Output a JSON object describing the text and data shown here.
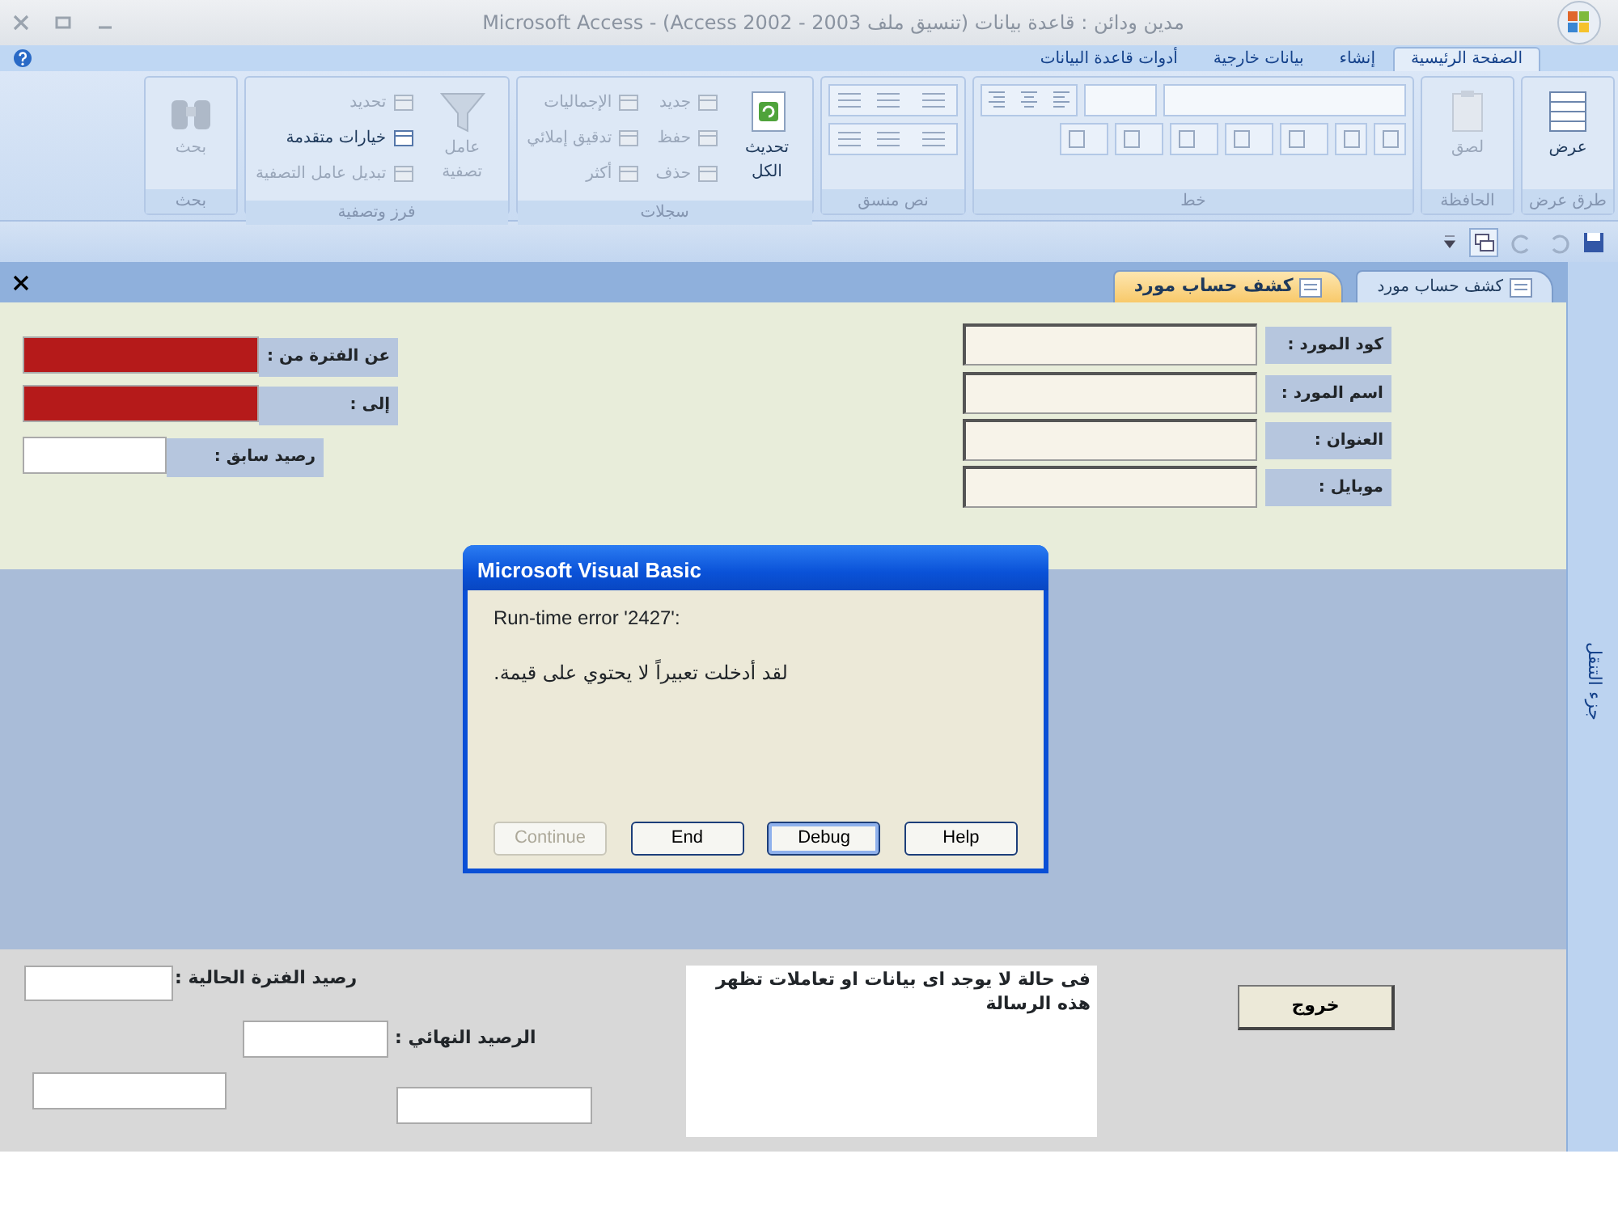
{
  "window": {
    "title": "مدين ودائن : قاعدة بيانات (تنسيق ملف Access 2002 - 2003) - Microsoft Access"
  },
  "ribbon_tabs": [
    {
      "label": "الصفحة الرئيسية",
      "selected": true
    },
    {
      "label": "إنشاء",
      "selected": false
    },
    {
      "label": "بيانات خارجية",
      "selected": false
    },
    {
      "label": "أدوات قاعدة البيانات",
      "selected": false
    }
  ],
  "ribbon_groups": [
    {
      "label": "طرق عرض",
      "kind": "items",
      "items": [
        {
          "label": "عرض",
          "kind": "large",
          "disabled": false
        }
      ]
    },
    {
      "label": "الحافظة",
      "kind": "items",
      "items": [
        {
          "label": "لصق",
          "kind": "large",
          "disabled": true
        }
      ]
    },
    {
      "label": "خط",
      "kind": "font"
    },
    {
      "label": "نص منسق",
      "kind": "rich_text"
    },
    {
      "label": "سجلات",
      "kind": "items",
      "items": [
        {
          "label": "تحديث الكل",
          "kind": "large",
          "disabled": false
        },
        {
          "label": "جديد",
          "kind": "small",
          "disabled": true
        },
        {
          "label": "حفظ",
          "kind": "small",
          "disabled": true
        },
        {
          "label": "حذف",
          "kind": "small",
          "disabled": true
        },
        {
          "label": "الإجماليات",
          "kind": "small",
          "disabled": true
        },
        {
          "label": "تدقيق إملائي",
          "kind": "small",
          "disabled": true
        },
        {
          "label": "أكثر",
          "kind": "small",
          "disabled": true
        }
      ]
    },
    {
      "label": "فرز وتصفية",
      "kind": "items",
      "items": [
        {
          "label": "عامل تصفية",
          "kind": "large",
          "disabled": true
        },
        {
          "label": "تحديد",
          "kind": "small",
          "disabled": true
        },
        {
          "label": "خيارات متقدمة",
          "kind": "small",
          "disabled": false
        },
        {
          "label": "تبديل عامل التصفية",
          "kind": "small",
          "disabled": true
        }
      ]
    },
    {
      "label": "بحث",
      "kind": "items",
      "items": [
        {
          "label": "بحث",
          "kind": "large",
          "disabled": true
        }
      ]
    }
  ],
  "document_tabs": [
    {
      "label": "كشف حساب مورد",
      "selected": false
    },
    {
      "label": "كشف حساب مورد",
      "selected": true
    }
  ],
  "navigation_pane": {
    "label": "جزء التنقل"
  },
  "form_header": {
    "supplier_fields": [
      {
        "label": "كود المورد :"
      },
      {
        "label": "اسم المورد :"
      },
      {
        "label": "العنوان :"
      },
      {
        "label": "موبايل :"
      }
    ],
    "period_fields": [
      {
        "label": "عن الفترة من :",
        "color": "#b51a1a"
      },
      {
        "label": "إلى :",
        "color": "#b51a1a"
      },
      {
        "label": "رصيد سابق :",
        "color": "#ffffff"
      }
    ]
  },
  "form_footer": {
    "current_balance_label": "رصيد الفترة الحالية :",
    "final_balance_label": "الرصيد النهائي :",
    "message": "فى حالة لا يوجد اى بيانات او تعاملات تظهر هذه الرسالة",
    "exit_button": "خروج"
  },
  "dialog": {
    "title": "Microsoft Visual Basic",
    "error": "Run-time error '2427':",
    "message": ".لقد أدخلت تعبيراً لا يحتوي على قيمة",
    "continue_button": {
      "label": "Continue",
      "disabled": true,
      "default": false
    },
    "end_button": {
      "label": "End",
      "disabled": false,
      "default": false
    },
    "debug_button": {
      "label": "Debug",
      "disabled": false,
      "default": true
    },
    "help_button": {
      "label": "Help",
      "disabled": false,
      "default": false
    }
  }
}
